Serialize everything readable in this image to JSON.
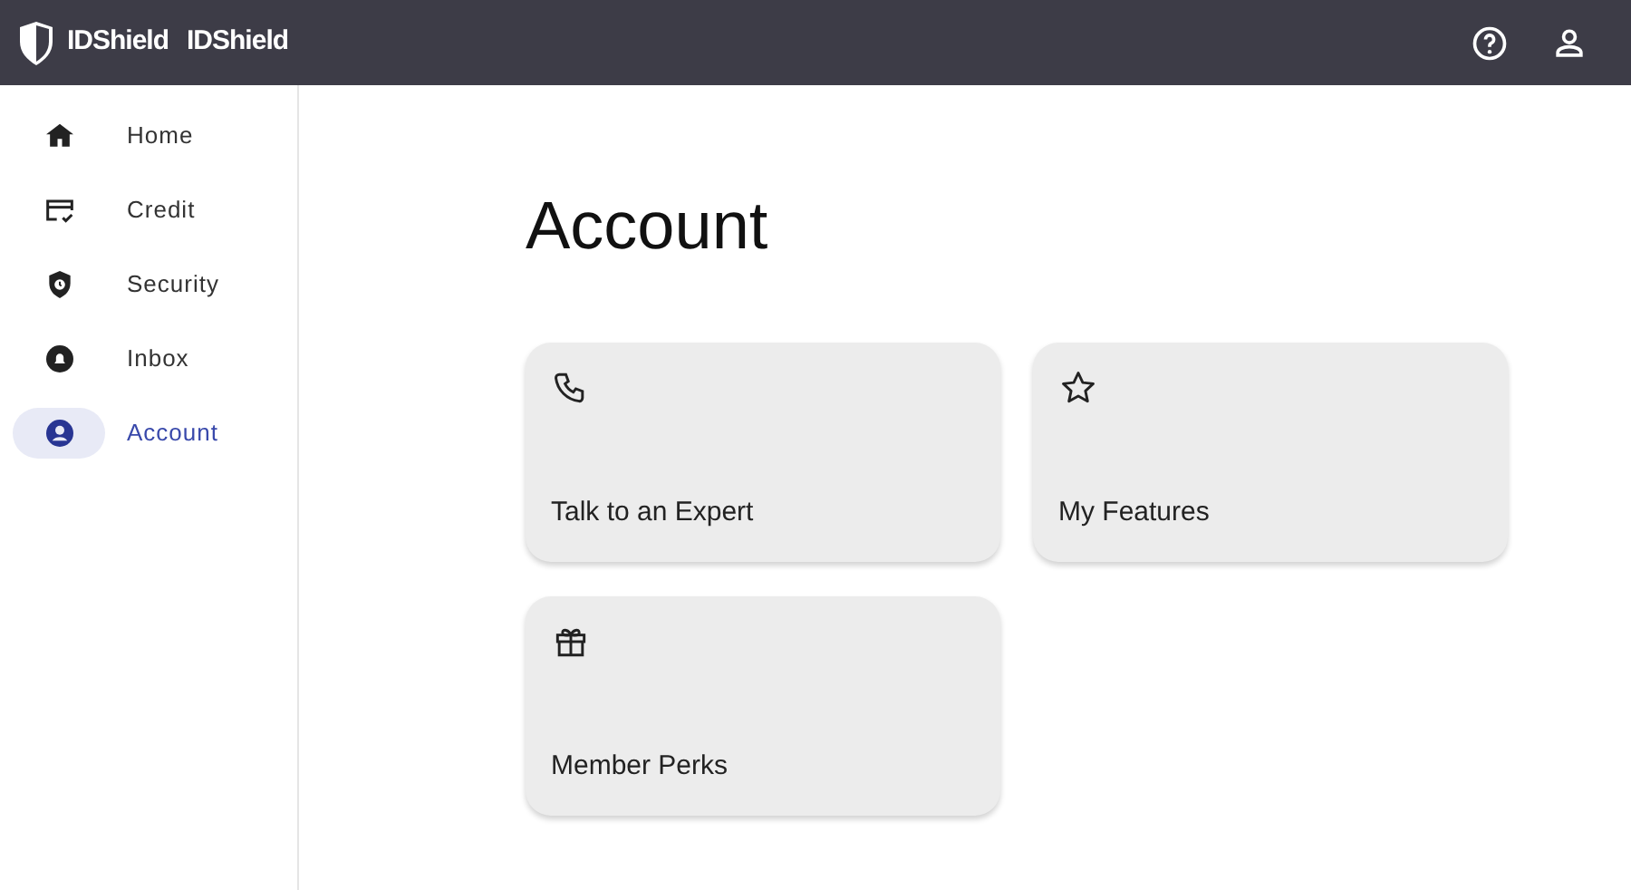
{
  "header": {
    "brand": [
      "IDShield",
      "IDShield"
    ],
    "actions": [
      {
        "kind": "help"
      },
      {
        "kind": "profile"
      }
    ]
  },
  "sidebar": {
    "items": [
      {
        "label": "Home",
        "kind": "home",
        "selected": false
      },
      {
        "label": "Credit",
        "kind": "credit",
        "selected": false
      },
      {
        "label": "Security",
        "kind": "security",
        "selected": false
      },
      {
        "label": "Inbox",
        "kind": "inbox",
        "selected": false
      },
      {
        "label": "Account",
        "kind": "account",
        "selected": true
      }
    ]
  },
  "page": {
    "title": "Account",
    "cards": [
      {
        "label": "Talk to an Expert",
        "kind": "phone"
      },
      {
        "label": "My Features",
        "kind": "star"
      },
      {
        "label": "Member Perks",
        "kind": "gift"
      }
    ]
  }
}
